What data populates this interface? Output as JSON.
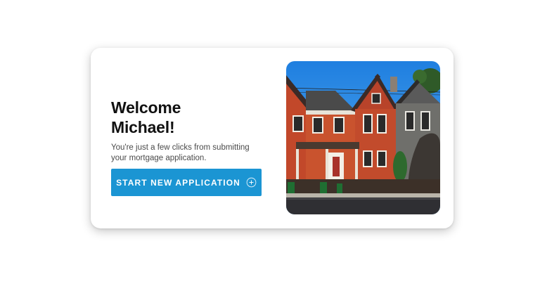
{
  "welcome_card": {
    "title_line1": "Welcome",
    "title_line2": "Michael!",
    "subtitle": "You're just a few clicks from submitting your mortgage application.",
    "cta_label": "START NEW APPLICATION",
    "cta_icon": "plus-circle-icon",
    "image": "row-of-brick-houses-photo"
  },
  "colors": {
    "accent": "#1b95d3",
    "title": "#111111",
    "subtitle": "#4a4a4a",
    "background": "#ffffff"
  }
}
